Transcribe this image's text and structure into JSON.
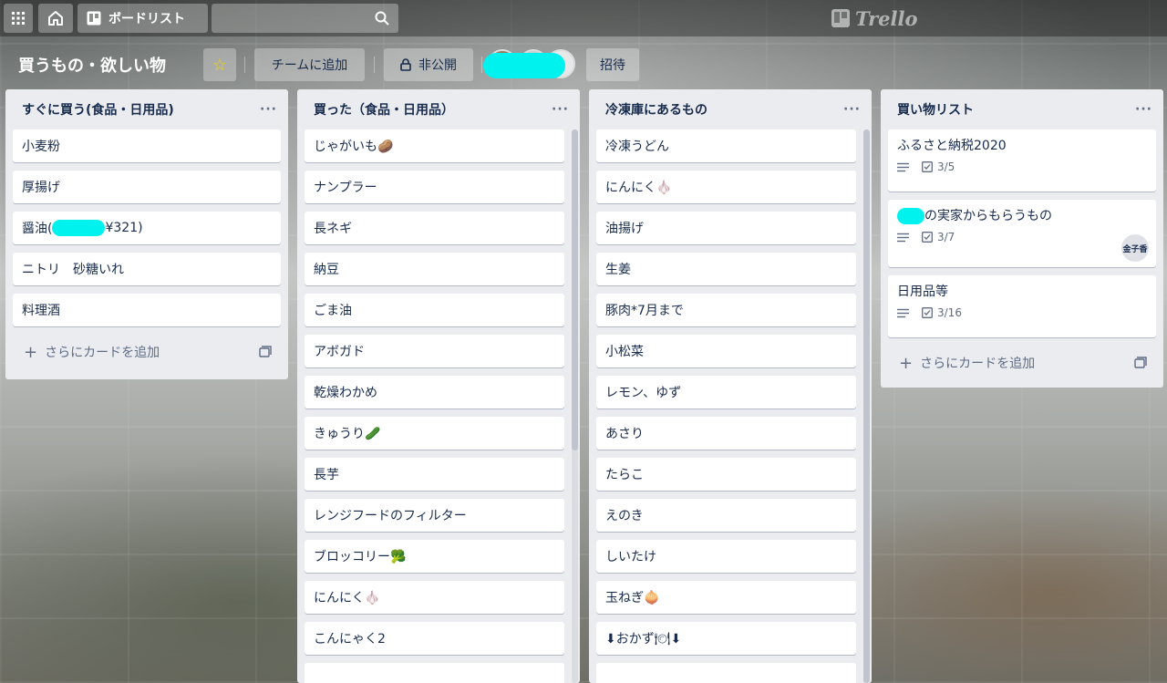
{
  "header": {
    "boards_label": "ボードリスト",
    "search_placeholder": "",
    "logo_text": "Trello"
  },
  "board": {
    "title": "買うもの・欲しい物",
    "team_label": "チームに追加",
    "visibility_label": "非公開",
    "invite_label": "招待"
  },
  "lists": [
    {
      "title": "すぐに買う(食品・日用品)",
      "cards": [
        "小麦粉",
        "厚揚げ",
        "醤油(",
        "ニトリ　砂糖いれ",
        "料理酒"
      ],
      "card3_suffix": "¥321)",
      "add_label": "さらにカードを追加"
    },
    {
      "title": "買った（食品・日用品）",
      "cards": [
        "じゃがいも🥔",
        "ナンプラー",
        "長ネギ",
        "納豆",
        "ごま油",
        "アボガド",
        "乾燥わかめ",
        "きゅうり🥒",
        "長芋",
        "レンジフードのフィルター",
        "ブロッコリー🥦",
        "にんにく🧄",
        "こんにゃく2"
      ]
    },
    {
      "title": "冷凍庫にあるもの",
      "cards": [
        "冷凍うどん",
        "にんにく🧄",
        "油揚げ",
        "生姜",
        "豚肉*7月まで",
        "小松菜",
        "レモン、ゆず",
        "あさり",
        "たらこ",
        "えのき",
        "しいたけ",
        "玉ねぎ🧅",
        "⬇おかず🍽⬇"
      ]
    },
    {
      "title": "買い物リスト",
      "cards": [
        {
          "title": "ふるさと納税2020",
          "checklist": "3/5"
        },
        {
          "title": "の実家からもらうもの",
          "checklist": "3/7",
          "member": "金子香"
        },
        {
          "title": "日用品等",
          "checklist": "3/16"
        }
      ],
      "add_label": "さらにカードを追加"
    }
  ],
  "colors": {
    "star": "#f2d600",
    "redaction": "#00f2ee",
    "list_bg": "#ebecf0"
  }
}
